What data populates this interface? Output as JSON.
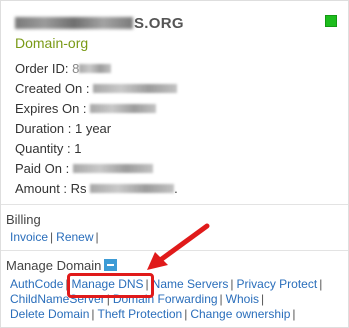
{
  "domain": {
    "name_suffix": "S.ORG",
    "product": "Domain-org",
    "status_color": "#1dbd1d"
  },
  "details": [
    {
      "label": "Order ID: ",
      "value": "8"
    },
    {
      "label": "Created On : ",
      "value": "2019-08-14"
    },
    {
      "label": "Expires On : ",
      "value": ""
    },
    {
      "label": "Duration : ",
      "value": "1 year"
    },
    {
      "label": "Quantity : ",
      "value": "1"
    },
    {
      "label": "Paid On : ",
      "value": "2019-08-14"
    },
    {
      "label": "Amount : ",
      "value": "Rs"
    }
  ],
  "billing": {
    "title": "Billing",
    "links": [
      "Invoice",
      "Renew"
    ]
  },
  "manage_domain": {
    "title": "Manage Domain",
    "row1": [
      "AuthCode",
      "Manage DNS",
      "Name Servers",
      "Privacy Protect"
    ],
    "row2": [
      "ChildNameServer",
      "Domain Forwarding",
      "Whois"
    ],
    "row3": [
      "Delete Domain",
      "Theft Protection",
      "Change ownership"
    ]
  },
  "separator": "|",
  "colors": {
    "link": "#2a6ebb",
    "product": "#7a9a16",
    "annotation": "#e01a1a",
    "toggle": "#3d9bd5"
  }
}
